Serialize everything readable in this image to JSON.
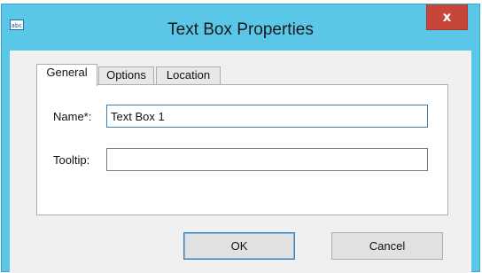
{
  "dialog": {
    "title": "Text Box Properties",
    "app_icon_text": "abc",
    "close_label": "x"
  },
  "tabs": [
    {
      "label": "General"
    },
    {
      "label": "Options"
    },
    {
      "label": "Location"
    }
  ],
  "fields": {
    "name": {
      "label": "Name*:",
      "value": "Text Box 1"
    },
    "tooltip": {
      "label": "Tooltip:",
      "value": ""
    }
  },
  "buttons": {
    "ok_label": "OK",
    "cancel_label": "Cancel"
  },
  "colors": {
    "titlebar": "#5bc7e8",
    "close_button": "#c7463a"
  }
}
